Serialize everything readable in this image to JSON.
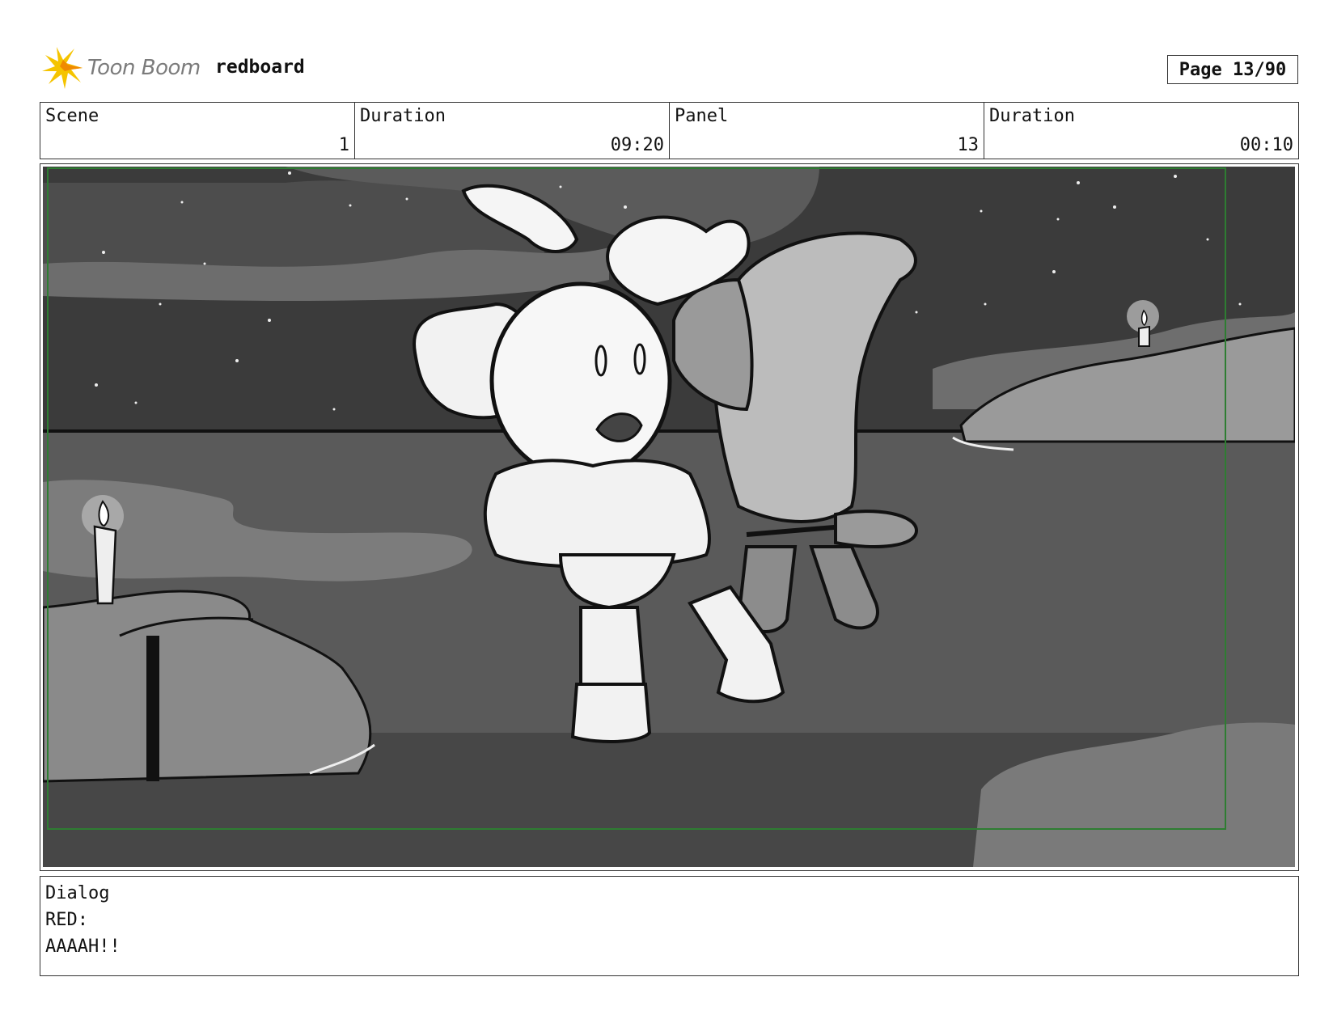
{
  "header": {
    "logo_text": "Toon Boom",
    "project_name": "redboard",
    "page_label": "Page 13/90"
  },
  "info": {
    "scene_label": "Scene",
    "scene_value": "1",
    "scene_duration_label": "Duration",
    "scene_duration_value": "09:20",
    "panel_label": "Panel",
    "panel_value": "13",
    "panel_duration_label": "Duration",
    "panel_duration_value": "00:10"
  },
  "dialog": {
    "label": "Dialog",
    "speaker": "RED:",
    "line": "AAAAH!!"
  },
  "colors": {
    "frame_border": "#333333",
    "safe_area": "#2e7d32",
    "logo_yellow": "#f5c400",
    "logo_text": "#7b7b7b"
  }
}
